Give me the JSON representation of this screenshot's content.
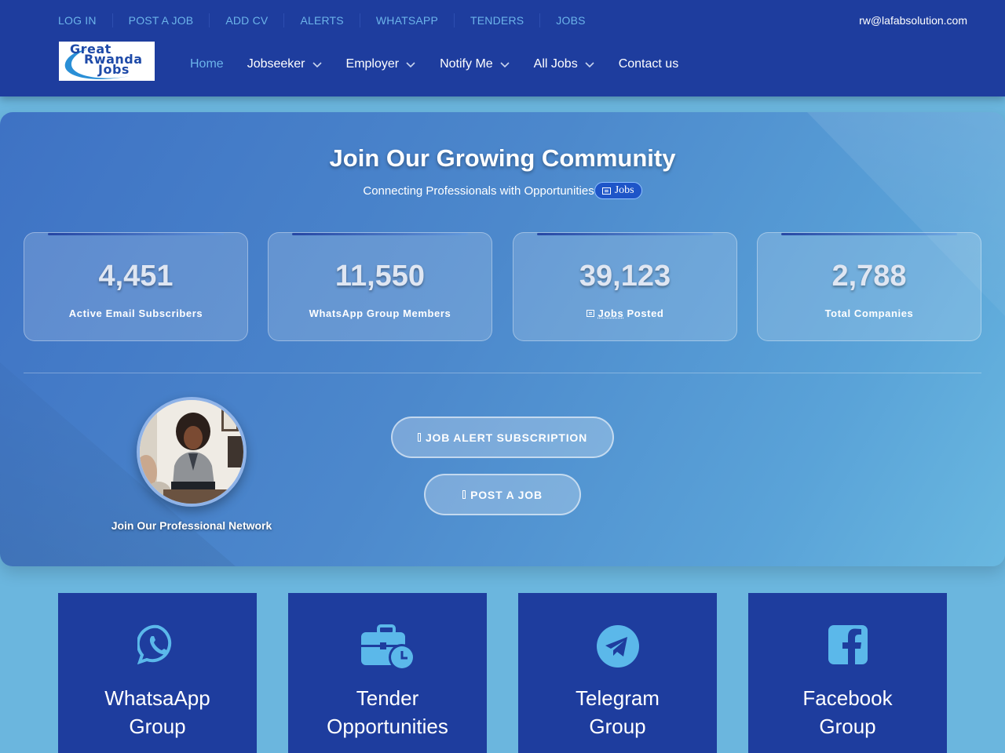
{
  "topbar": {
    "links": [
      "LOG IN",
      "POST A JOB",
      "ADD CV",
      "ALERTS",
      "WHATSAPP",
      "TENDERS",
      "JOBS"
    ],
    "email": "rw@lafabsolution.com"
  },
  "logo": {
    "line1": "Great",
    "line2": "Rwanda",
    "line3": "Jobs"
  },
  "nav": {
    "home": "Home",
    "jobseeker": "Jobseeker",
    "employer": "Employer",
    "notify": "Notify Me",
    "alljobs": "All Jobs",
    "contact": "Contact us"
  },
  "hero": {
    "title": "Join Our Growing Community",
    "subtitle": "Connecting Professionals with Opportunities",
    "pill": "Jobs",
    "stats": [
      {
        "value": "4,451",
        "label": "Active Email Subscribers"
      },
      {
        "value": "11,550",
        "label": "WhatsApp Group Members"
      },
      {
        "value": "39,123",
        "label_main": "Jobs",
        "label_rest": " Posted"
      },
      {
        "value": "2,788",
        "label": "Total Companies"
      }
    ],
    "avatar_caption": "Join Our Professional Network",
    "btn_alert": "JOB ALERT SUBSCRIPTION",
    "btn_post": "POST A JOB"
  },
  "cards": [
    {
      "line1": "WhatsaApp",
      "line2": "Group",
      "icon": "whatsapp-icon"
    },
    {
      "line1": "Tender",
      "line2": "Opportunities",
      "icon": "briefcase-clock-icon"
    },
    {
      "line1": "Telegram",
      "line2": "Group",
      "icon": "telegram-icon"
    },
    {
      "line1": "Facebook",
      "line2": "Group",
      "icon": "facebook-icon"
    }
  ],
  "colors": {
    "header": "#1e3d9e",
    "accent": "#6cb4ea",
    "icon": "#5bb8ea",
    "page": "#6bb6de"
  }
}
